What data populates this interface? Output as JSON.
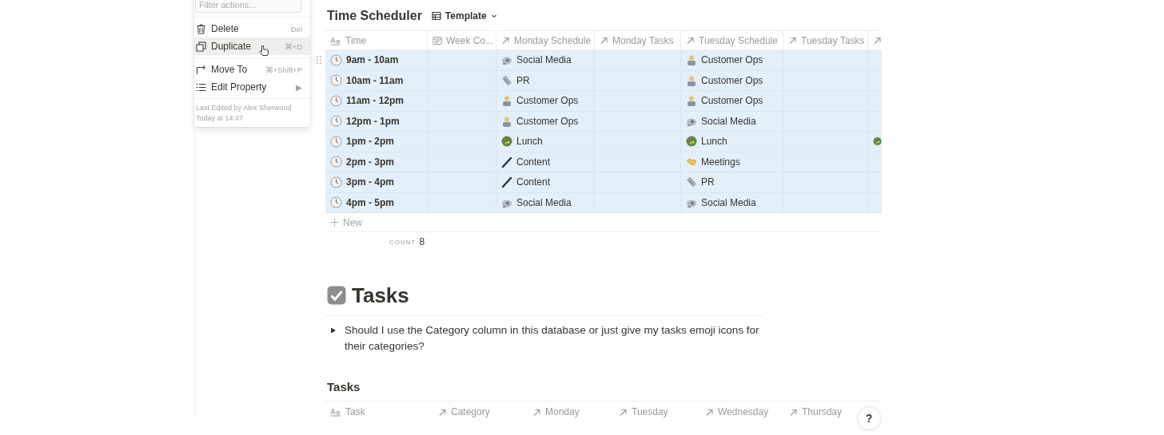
{
  "menu": {
    "filter": {
      "placeholder": "Filter actions..."
    },
    "groups": [
      [
        {
          "kind": "delete",
          "label": "Delete",
          "hint": "Del",
          "selected": false
        },
        {
          "kind": "duplicate",
          "label": "Duplicate",
          "hint": "⌘+D",
          "selected": true
        }
      ],
      [
        {
          "kind": "move",
          "label": "Move To",
          "hint": "⌘+Shift+P",
          "selected": false
        },
        {
          "kind": "property",
          "label": "Edit Property",
          "hint": "▶",
          "selected": false
        }
      ]
    ],
    "footer": [
      "Last Edited by Alex Sherwood",
      "Today at 14:47"
    ]
  },
  "scheduler": {
    "title": "Time Scheduler",
    "view": "Template",
    "columns": [
      {
        "kind": "text",
        "label": "Time"
      },
      {
        "kind": "date",
        "label": "Week Co..."
      },
      {
        "kind": "relation",
        "label": "Monday Schedule"
      },
      {
        "kind": "relation",
        "label": "Monday Tasks"
      },
      {
        "kind": "relation",
        "label": "Tuesday Schedule"
      },
      {
        "kind": "relation",
        "label": "Tuesday Tasks"
      },
      {
        "kind": "relation"
      }
    ],
    "rows": [
      {
        "selected": true,
        "time": "9am - 10am",
        "monday_schedule": {
          "kind": "satellite",
          "text": "Social Media"
        },
        "tuesday_schedule": {
          "kind": "worker",
          "text": "Customer Ops"
        }
      },
      {
        "selected": true,
        "time": "10am - 11am",
        "monday_schedule": {
          "kind": "newspaper",
          "text": "PR"
        },
        "tuesday_schedule": {
          "kind": "worker",
          "text": "Customer Ops"
        }
      },
      {
        "selected": true,
        "time": "11am - 12pm",
        "monday_schedule": {
          "kind": "worker",
          "text": "Customer Ops"
        },
        "tuesday_schedule": {
          "kind": "worker",
          "text": "Customer Ops"
        }
      },
      {
        "selected": true,
        "time": "12pm - 1pm",
        "monday_schedule": {
          "kind": "worker",
          "text": "Customer Ops"
        },
        "tuesday_schedule": {
          "kind": "satellite",
          "text": "Social Media"
        }
      },
      {
        "selected": true,
        "time": "1pm - 2pm",
        "monday_schedule": {
          "kind": "salad",
          "text": "Lunch"
        },
        "tuesday_schedule": {
          "kind": "salad",
          "text": "Lunch"
        },
        "column_7": {
          "kind": "salad"
        }
      },
      {
        "selected": true,
        "time": "2pm - 3pm",
        "monday_schedule": {
          "kind": "pen",
          "text": "Content"
        },
        "tuesday_schedule": {
          "kind": "handshake",
          "text": "Meetings"
        }
      },
      {
        "selected": true,
        "time": "3pm - 4pm",
        "monday_schedule": {
          "kind": "pen",
          "text": "Content"
        },
        "tuesday_schedule": {
          "kind": "newspaper",
          "text": "PR"
        }
      },
      {
        "selected": true,
        "time": "4pm - 5pm",
        "monday_schedule": {
          "kind": "satellite",
          "text": "Social Media"
        },
        "tuesday_schedule": {
          "kind": "satellite",
          "text": "Social Media"
        }
      }
    ],
    "new_row": "New",
    "count_label": "COUNT",
    "count": "8"
  },
  "tasks_heading": "Tasks",
  "toggle": {
    "expanded": false,
    "text": "Should I use the Category column in this database or just give my tasks emoji icons for their categories?"
  },
  "tasks_table": {
    "title": "Tasks",
    "columns": [
      {
        "kind": "text",
        "label": "Task"
      },
      {
        "kind": "relation",
        "label": "Category"
      },
      {
        "kind": "relation",
        "label": "Monday"
      },
      {
        "kind": "relation",
        "label": "Tuesday"
      },
      {
        "kind": "relation",
        "label": "Wednesday"
      },
      {
        "kind": "relation",
        "label": "Thursday"
      }
    ]
  },
  "help": "?"
}
